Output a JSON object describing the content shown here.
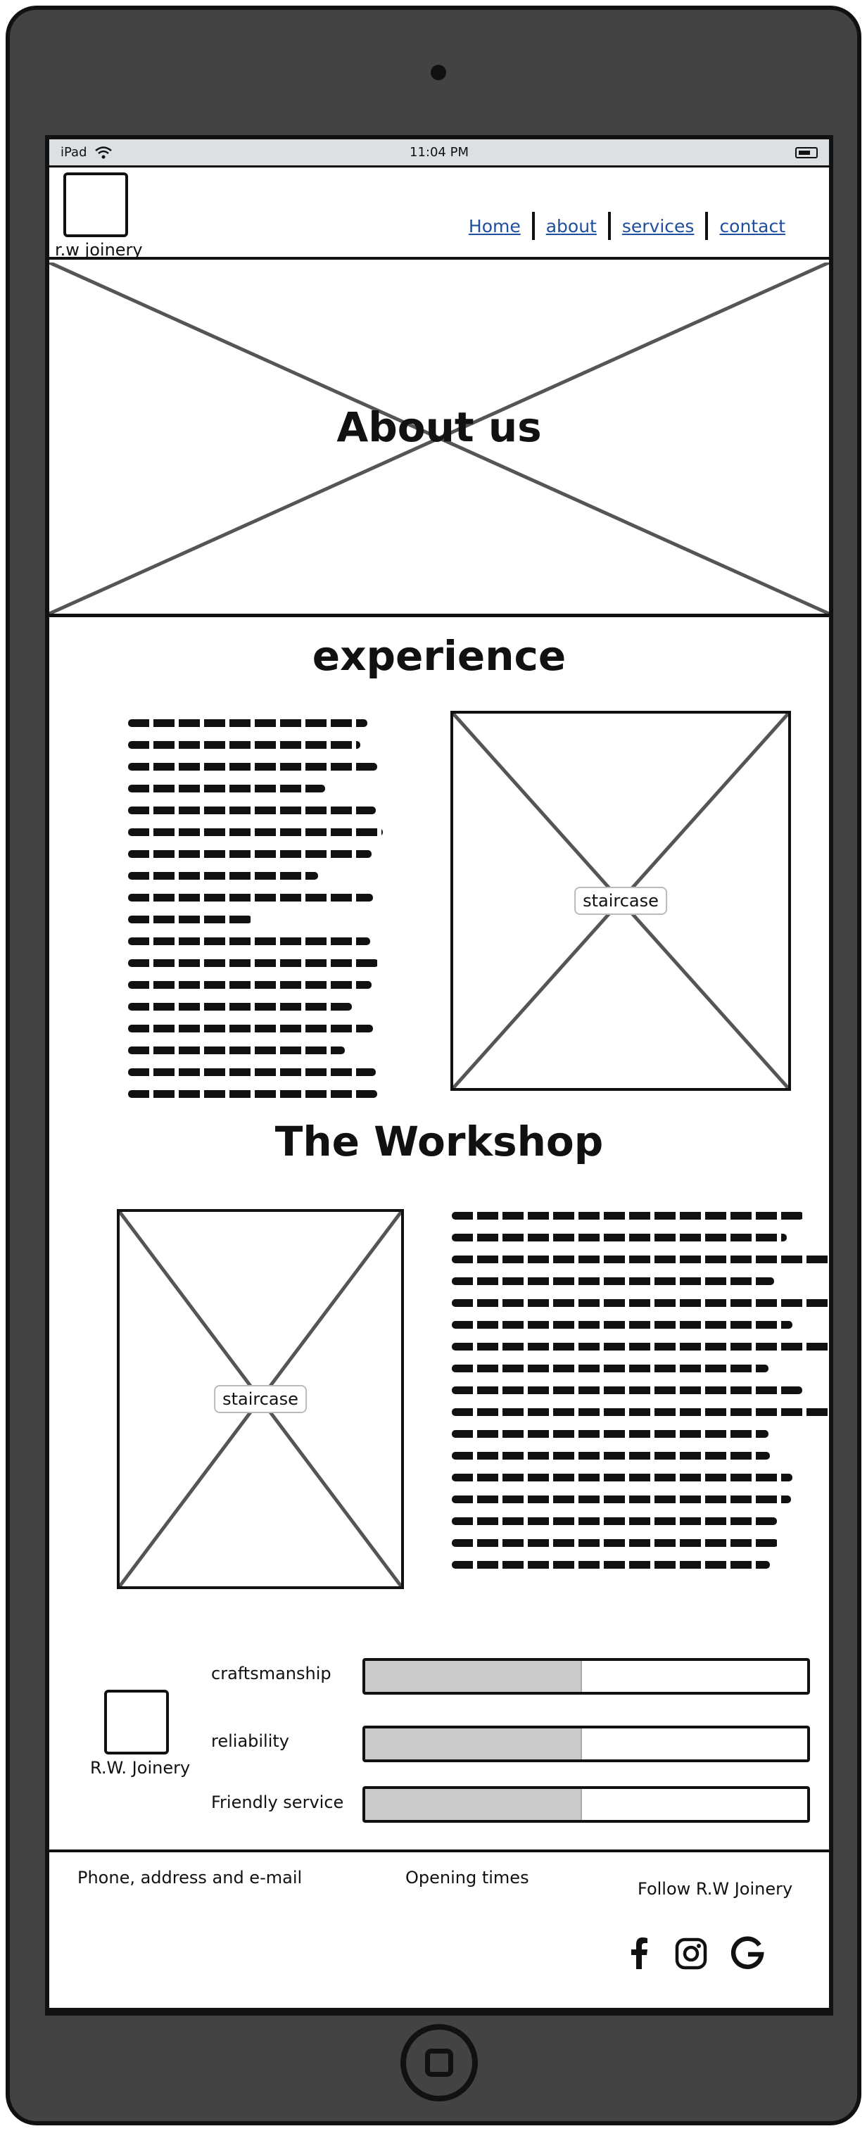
{
  "status_bar": {
    "device": "iPad",
    "time": "11:04 PM"
  },
  "header": {
    "logo_text": "r.w joinery",
    "nav": [
      {
        "label": "Home"
      },
      {
        "label": "about"
      },
      {
        "label": "services"
      },
      {
        "label": "contact"
      }
    ]
  },
  "hero": {
    "title": "About us"
  },
  "experience": {
    "title": "experience",
    "image_label": "staircase"
  },
  "workshop": {
    "title": "The Workshop",
    "image_label": "staircase"
  },
  "skills": {
    "brand": "R.W. Joinery",
    "items": [
      {
        "label": "craftsmanship",
        "level": 0.49
      },
      {
        "label": "reliability",
        "level": 0.49
      },
      {
        "label": "Friendly service",
        "level": 0.49
      }
    ]
  },
  "footer": {
    "contact": "Phone, address and e-mail",
    "hours": "Opening times",
    "follow": "Follow R.W Joinery",
    "social_icons": [
      "facebook-icon",
      "instagram-icon",
      "google-icon"
    ]
  }
}
